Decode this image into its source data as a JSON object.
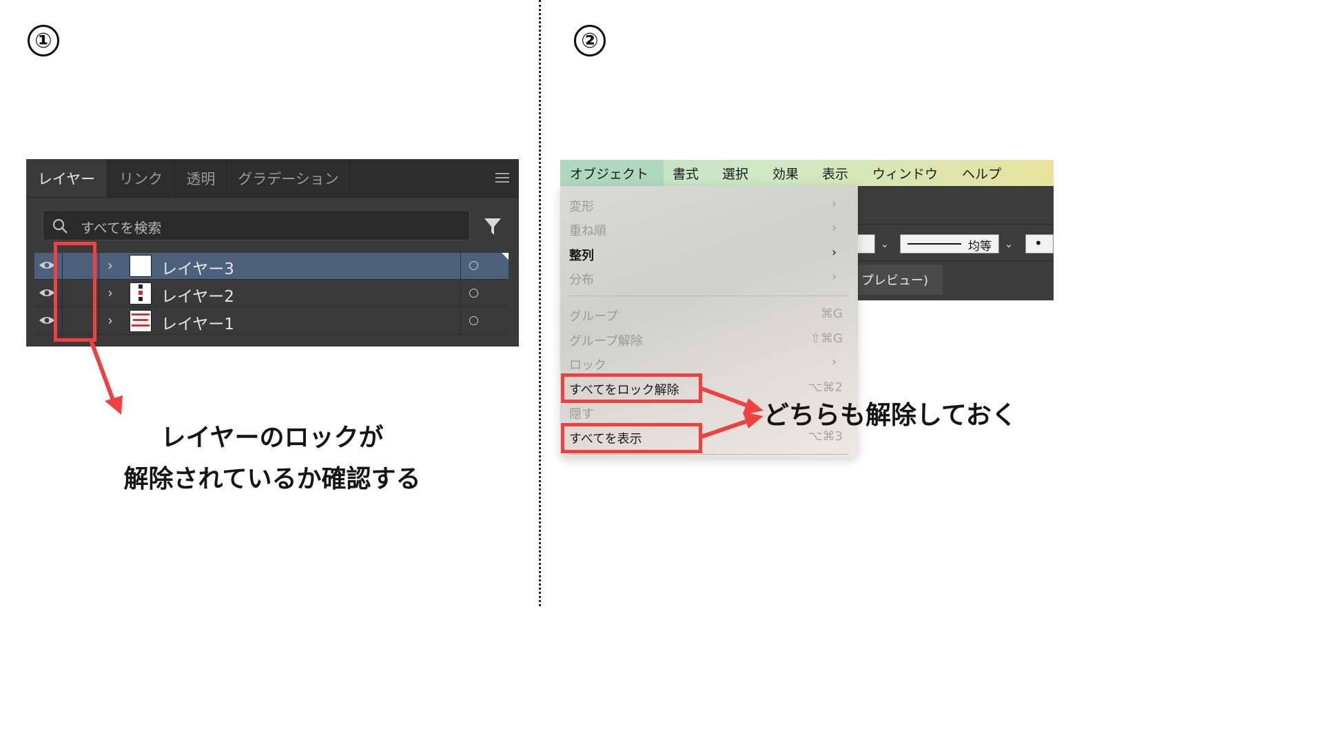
{
  "steps": {
    "one": "①",
    "two": "②"
  },
  "layers_panel": {
    "tabs": [
      "レイヤー",
      "リンク",
      "透明",
      "グラデーション"
    ],
    "search_placeholder": "すべてを検索",
    "layers": [
      {
        "name": "レイヤー3",
        "selected": true
      },
      {
        "name": "レイヤー2",
        "selected": false
      },
      {
        "name": "レイヤー1",
        "selected": false
      }
    ]
  },
  "caption1": {
    "line1": "レイヤーのロックが",
    "line2": "解除されているか確認する"
  },
  "menubar": {
    "items": [
      "オブジェクト",
      "書式",
      "選択",
      "効果",
      "表示",
      "ウィンドウ",
      "ヘルプ"
    ]
  },
  "object_menu": {
    "items": [
      {
        "label": "変形",
        "shortcut": "",
        "submenu": true,
        "enabled": false
      },
      {
        "label": "重ね順",
        "shortcut": "",
        "submenu": true,
        "enabled": false
      },
      {
        "label": "整列",
        "shortcut": "",
        "submenu": true,
        "enabled": true
      },
      {
        "label": "分布",
        "shortcut": "",
        "submenu": true,
        "enabled": false
      },
      {
        "label": "グループ",
        "shortcut": "⌘G",
        "submenu": false,
        "enabled": false
      },
      {
        "label": "グループ解除",
        "shortcut": "⇧⌘G",
        "submenu": false,
        "enabled": false
      },
      {
        "label": "ロック",
        "shortcut": "",
        "submenu": true,
        "enabled": false
      },
      {
        "label": "すべてをロック解除",
        "shortcut": "⌥⌘2",
        "submenu": false,
        "enabled": true
      },
      {
        "label": "隠す",
        "shortcut": "",
        "submenu": false,
        "enabled": false
      },
      {
        "label": "すべてを表示",
        "shortcut": "⌥⌘3",
        "submenu": false,
        "enabled": true
      }
    ]
  },
  "background_app": {
    "stroke_profile": "均等",
    "preview_tab": "プレビュー)"
  },
  "caption2": "どちらも解除しておく",
  "colors": {
    "highlight": "#f04040",
    "panel": "#3a3a3a",
    "selected_row": "#4b607a"
  }
}
